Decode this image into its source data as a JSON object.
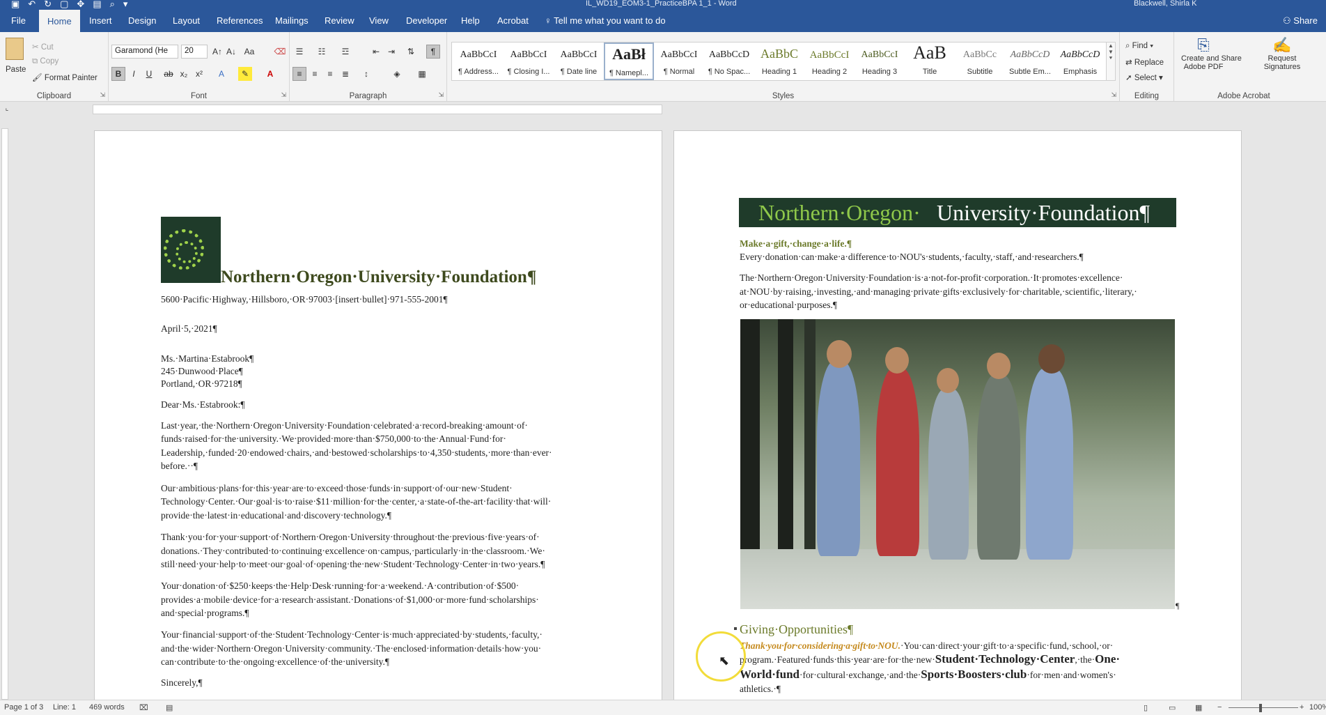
{
  "window": {
    "title": "IL_WD19_EOM3-1_PracticeBPA 1_1  -  Word",
    "user": "Blackwell, Shirla K"
  },
  "tabs": [
    "File",
    "Home",
    "Insert",
    "Design",
    "Layout",
    "References",
    "Mailings",
    "Review",
    "View",
    "Developer",
    "Help",
    "Acrobat"
  ],
  "tell_me": "Tell me what you want to do",
  "share": "Share",
  "ribbon": {
    "clipboard": {
      "paste": "Paste",
      "cut": "Cut",
      "copy": "Copy",
      "format_painter": "Format Painter",
      "label": "Clipboard"
    },
    "font": {
      "name": "Garamond (He",
      "size": "20",
      "label": "Font"
    },
    "paragraph": {
      "label": "Paragraph"
    },
    "styles": {
      "label": "Styles",
      "items": [
        {
          "sample": "AaBbCcI",
          "name": "¶ Address..."
        },
        {
          "sample": "AaBbCcI",
          "name": "¶ Closing I..."
        },
        {
          "sample": "AaBbCcI",
          "name": "¶ Date line"
        },
        {
          "sample": "AaBł",
          "name": "¶ Namepl..."
        },
        {
          "sample": "AaBbCcI",
          "name": "¶ Normal"
        },
        {
          "sample": "AaBbCcD",
          "name": "¶ No Spac..."
        },
        {
          "sample": "AaBbC",
          "name": "Heading 1"
        },
        {
          "sample": "AaBbCcI",
          "name": "Heading 2"
        },
        {
          "sample": "AaBbCcI",
          "name": "Heading 3"
        },
        {
          "sample": "AaB",
          "name": "Title"
        },
        {
          "sample": "AaBbCc",
          "name": "Subtitle"
        },
        {
          "sample": "AaBbCcD",
          "name": "Subtle Em..."
        },
        {
          "sample": "AaBbCcD",
          "name": "Emphasis"
        }
      ]
    },
    "editing": {
      "find": "Find",
      "replace": "Replace",
      "select": "Select",
      "label": "Editing"
    },
    "acrobat": {
      "create_share": "Create and Share",
      "create_share2": "Adobe PDF",
      "request": "Request",
      "request2": "Signatures",
      "label": "Adobe Acrobat"
    }
  },
  "page1": {
    "org_name": "Northern·Oregon·University·Foundation¶",
    "logo_text": "Northern Oregon University Foundation",
    "address": "5600·Pacific·Highway,·Hillsboro,·OR·97003·[insert·bullet]·971-555-2001¶",
    "date": "April·5,·2021¶",
    "recipient": [
      "Ms.·Martina·Estabrook¶",
      "245·Dunwood·Place¶",
      "Portland,·OR·97218¶"
    ],
    "salutation": "Dear·Ms.·Estabrook:¶",
    "paragraphs": [
      [
        "Last·year,·the·Northern·Oregon·University·Foundation·celebrated·a·record-breaking·amount·of·",
        "funds·raised·for·the·university.·We·provided·more·than·$750,000·to·the·Annual·Fund·for·",
        "Leadership,·funded·20·endowed·chairs,·and·bestowed·scholarships·to·4,350·students,·more·than·ever·",
        "before.··¶"
      ],
      [
        "Our·ambitious·plans·for·this·year·are·to·exceed·those·funds·in·support·of·our·new·Student·",
        "Technology·Center.·Our·goal·is·to·raise·$11·million·for·the·center,·a·state-of-the-art·facility·that·will·",
        "provide·the·latest·in·educational·and·discovery·technology.¶"
      ],
      [
        "Thank·you·for·your·support·of·Northern·Oregon·University·throughout·the·previous·five·years·of·",
        "donations.·They·contributed·to·continuing·excellence·on·campus,·particularly·in·the·classroom.·We·",
        "still·need·your·help·to·meet·our·goal·of·opening·the·new·Student·Technology·Center·in·two·years.¶"
      ],
      [
        "Your·donation·of·$250·keeps·the·Help·Desk·running·for·a·weekend.·A·contribution·of·$500·",
        "provides·a·mobile·device·for·a·research·assistant.·Donations·of·$1,000·or·more·fund·scholarships·",
        "and·special·programs.¶"
      ],
      [
        "Your·financial·support·of·the·Student·Technology·Center·is·much·appreciated·by·students,·faculty,·",
        "and·the·wider·Northern·Oregon·University·community.·The·enclosed·information·details·how·you·",
        "can·contribute·to·the·ongoing·excellence·of·the·university.¶"
      ]
    ],
    "closing": "Sincerely,¶"
  },
  "page2": {
    "banner_part1": "Northern·Oregon·",
    "banner_part2": "University·Foundation¶",
    "tagline": "Make·a·gift,·change·a·life.¶",
    "intro": "Every·donation·can·make·a·difference·to·NOU's·students,·faculty,·staff,·and·researchers.¶",
    "about": [
      "The·Northern·Oregon·University·Foundation·is·a·not-for-profit·corporation.·It·promotes·excellence·",
      "at·NOU·by·raising,·investing,·and·managing·private·gifts·exclusively·for·charitable,·scientific,·literary,·",
      "or·educational·purposes.¶"
    ],
    "photo_mark": "¶",
    "giving_heading": "Giving·Opportunities¶",
    "giving_italic": "Thank·you·for·considering·a·gift·to·NOU.",
    "giving_line1_rest": "·You·can·direct·your·gift·to·a·specific·fund,·school,·or·",
    "giving_line2_a": "program.·Featured·funds·this·year·are·for·the·new·",
    "giving_bold1": "Student·Technology·Center",
    "giving_line2_b": ",·the·",
    "giving_bold2": "One·",
    "giving_bold3": "World·fund",
    "giving_line3_a": "·for·cultural·exchange,·and·the·",
    "giving_bold4": "Sports·Boosters·club",
    "giving_line3_b": "·for·men·and·women's·",
    "giving_line4": "athletics.·¶"
  },
  "status": {
    "page": "Page 1 of 3",
    "line": "Line: 1",
    "words": "469 words",
    "zoom": "100%"
  }
}
